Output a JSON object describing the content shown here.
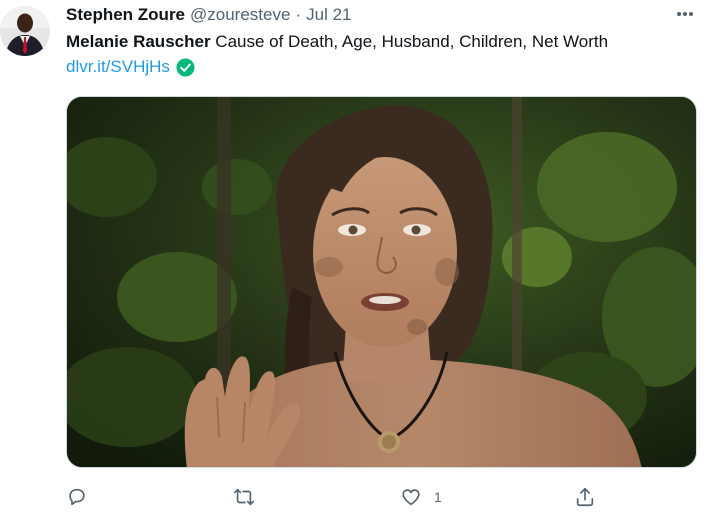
{
  "tweet": {
    "author": {
      "name": "Stephen Zoure",
      "handle": "@zouresteve",
      "separator": "·",
      "date": "Jul 21"
    },
    "text_bold": "Melanie Rauscher",
    "text_rest": " Cause of Death, Age, Husband, Children, Net Worth",
    "link": "dlvr.it/SVHjHs",
    "link_badge_icon": "check-circle-icon",
    "more_icon": "more-dots-icon",
    "media": {
      "description_icon": "photo"
    },
    "actions": {
      "reply_icon": "reply-icon",
      "retweet_icon": "retweet-icon",
      "like_icon": "heart-icon",
      "like_count": "1",
      "share_icon": "share-icon"
    }
  },
  "colors": {
    "link": "#1d9bf0",
    "muted": "#536471",
    "text": "#0f1419",
    "badge": "#00ba7c"
  }
}
